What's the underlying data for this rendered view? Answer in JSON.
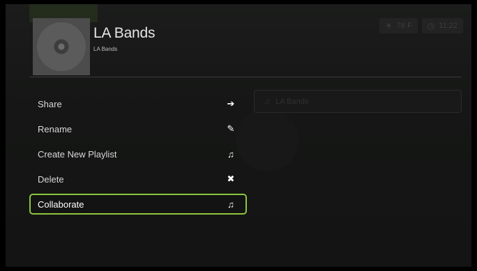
{
  "header": {
    "title": "LA Bands",
    "subtitle": "LA Bands"
  },
  "status": {
    "temperature": "76 F",
    "time": "11:22",
    "weather_icon": "sun-icon",
    "clock_icon": "clock-icon"
  },
  "background_list": {
    "item": "LA Bands",
    "icon": "music-note-icon"
  },
  "menu": {
    "items": [
      {
        "label": "Share",
        "icon": "arrow-right-icon",
        "glyph": "➔"
      },
      {
        "label": "Rename",
        "icon": "pencil-icon",
        "glyph": "✎"
      },
      {
        "label": "Create New Playlist",
        "icon": "new-playlist-icon",
        "glyph": "♫"
      },
      {
        "label": "Delete",
        "icon": "close-icon",
        "glyph": "✖"
      },
      {
        "label": "Collaborate",
        "icon": "collaborate-icon",
        "glyph": "♫"
      }
    ],
    "selected_index": 4
  },
  "colors": {
    "accent": "#8cc63e",
    "background": "#151615",
    "text": "#d8d8d8"
  }
}
